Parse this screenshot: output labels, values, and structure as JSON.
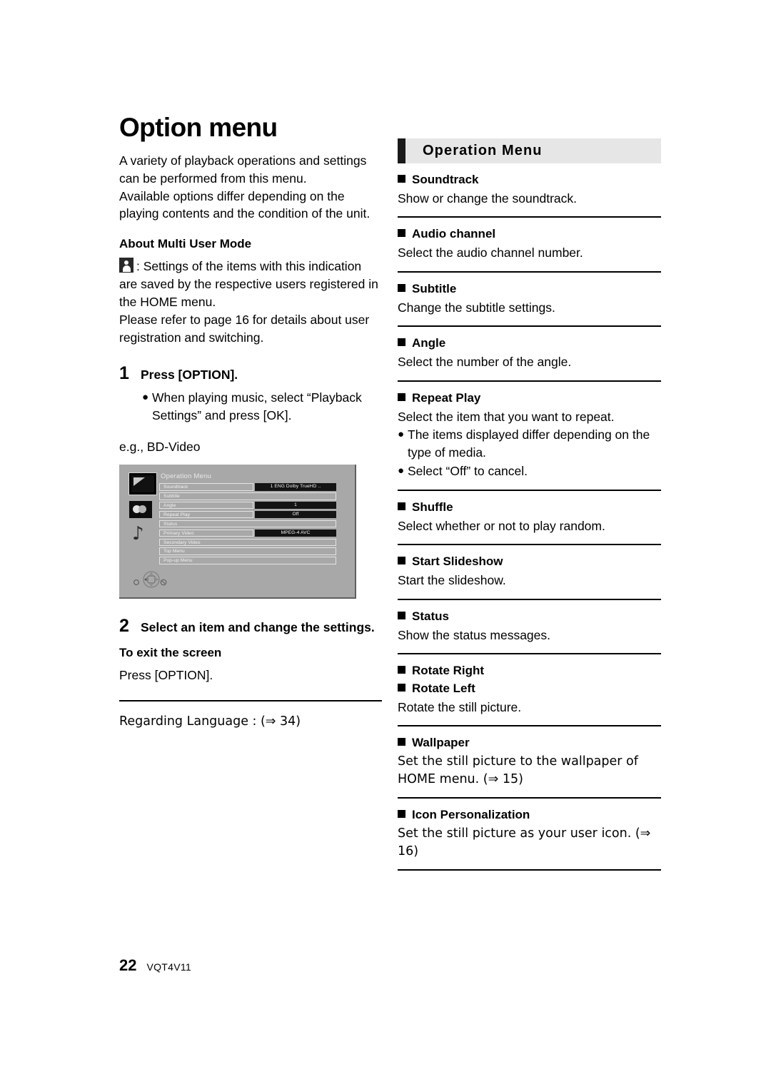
{
  "left": {
    "title": "Option menu",
    "intro_p1": "A variety of playback operations and settings can be performed from this menu.",
    "intro_p2": "Available options differ depending on the playing contents and the condition of the unit.",
    "multi_user_heading": "About Multi User Mode",
    "multi_user_icon": "user-silhouette-icon",
    "multi_user_p1": ": Settings of the items with this indication are saved by the respective users registered in the HOME menu.",
    "multi_user_p2": "Please refer to page 16 for details about user registration and switching.",
    "step1_num": "1",
    "step1_text": "Press [OPTION].",
    "step1_bullet": "When playing music, select “Playback Settings” and press [OK].",
    "eg_label": "e.g., BD-Video",
    "step2_num": "2",
    "step2_text": "Select an item and change the settings.",
    "exit_heading": "To exit the screen",
    "exit_text": "Press [OPTION].",
    "regarding_language": "Regarding Language : (⇒ 34)"
  },
  "tv_mockup": {
    "title": "Operation Menu",
    "icons": [
      "video-screen-icon",
      "picture-disc-icon",
      "music-note-icon"
    ],
    "dpad": "dpad-navigation-icon",
    "rows": [
      {
        "label": "Soundtrack",
        "value": "1 ENG Dolby TrueHD   .."
      },
      {
        "label": "Subtitle",
        "value": ""
      },
      {
        "label": "Angle",
        "value": "1"
      },
      {
        "label": "Repeat Play",
        "value": "Off"
      },
      {
        "label": "Status",
        "value": ""
      },
      {
        "label": "Primary Video",
        "value": "MPEG-4 AVC"
      },
      {
        "label": "Secondary Video",
        "value": ""
      },
      {
        "label": "Top Menu",
        "value": ""
      },
      {
        "label": "Pop-up Menu",
        "value": ""
      }
    ]
  },
  "right": {
    "header": "Operation Menu",
    "entries": [
      {
        "title": "Soundtrack",
        "desc": "Show or change the soundtrack."
      },
      {
        "title": "Audio channel",
        "desc": "Select the audio channel number."
      },
      {
        "title": "Subtitle",
        "desc": "Change the subtitle settings."
      },
      {
        "title": "Angle",
        "desc": "Select the number of the angle."
      },
      {
        "title": "Repeat Play",
        "desc": "Select the item that you want to repeat.",
        "bullets": [
          "The items displayed differ depending on the type of media.",
          "Select “Off” to cancel."
        ]
      },
      {
        "title": "Shuffle",
        "desc": "Select whether or not to play random."
      },
      {
        "title": "Start Slideshow",
        "desc": "Start the slideshow."
      },
      {
        "title": "Status",
        "desc": "Show the status messages."
      },
      {
        "title": "Rotate Right",
        "title2": "Rotate Left",
        "desc": "Rotate the still picture."
      },
      {
        "title": "Wallpaper",
        "desc": "Set the still picture to the wallpaper of HOME menu. (⇒ 15)"
      },
      {
        "title": "Icon Personalization",
        "desc": "Set the still picture as your user icon. (⇒ 16)"
      }
    ]
  },
  "footer": {
    "page_number": "22",
    "doc_code": "VQT4V11"
  },
  "colors": {
    "text": "#000000",
    "header_band": "#e6e6e6",
    "header_bar": "#1a1a1a",
    "tv_background": "#a8a8a8",
    "tv_value_bg": "#141414"
  }
}
